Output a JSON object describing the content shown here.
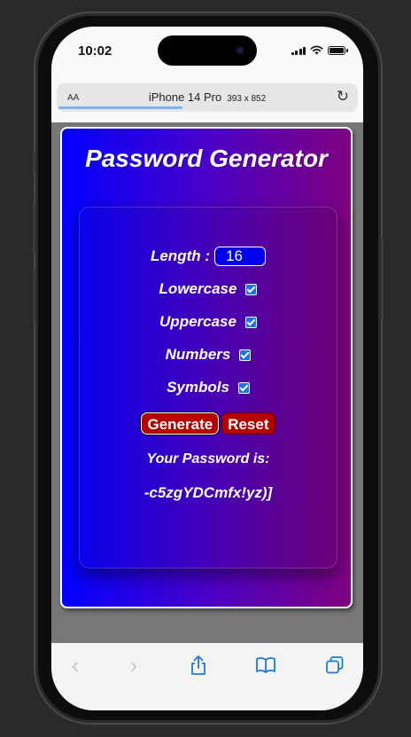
{
  "status_bar": {
    "time": "10:02"
  },
  "browser": {
    "text_size_label": "AA",
    "device_name": "iPhone 14 Pro",
    "device_dims": "393 x 852",
    "reload_icon": "reload-icon"
  },
  "app": {
    "title": "Password Generator",
    "length_label": "Length :",
    "length_value": "16",
    "options": [
      {
        "label": "Lowercase",
        "checked": true
      },
      {
        "label": "Uppercase",
        "checked": true
      },
      {
        "label": "Numbers",
        "checked": true
      },
      {
        "label": "Symbols",
        "checked": true
      }
    ],
    "generate_label": "Generate",
    "reset_label": "Reset",
    "result_label": "Your Password is:",
    "password": "-c5zgYDCmfx!yz)]"
  },
  "toolbar": {
    "items": [
      "back-icon",
      "forward-icon",
      "share-icon",
      "bookmarks-icon",
      "tabs-icon"
    ]
  },
  "colors": {
    "gradient_start": "#0000ff",
    "gradient_end": "#7f0080",
    "button_red": "#b40000",
    "checkbox_blue": "#1a73e8",
    "ios_blue": "#1a7ae0"
  }
}
